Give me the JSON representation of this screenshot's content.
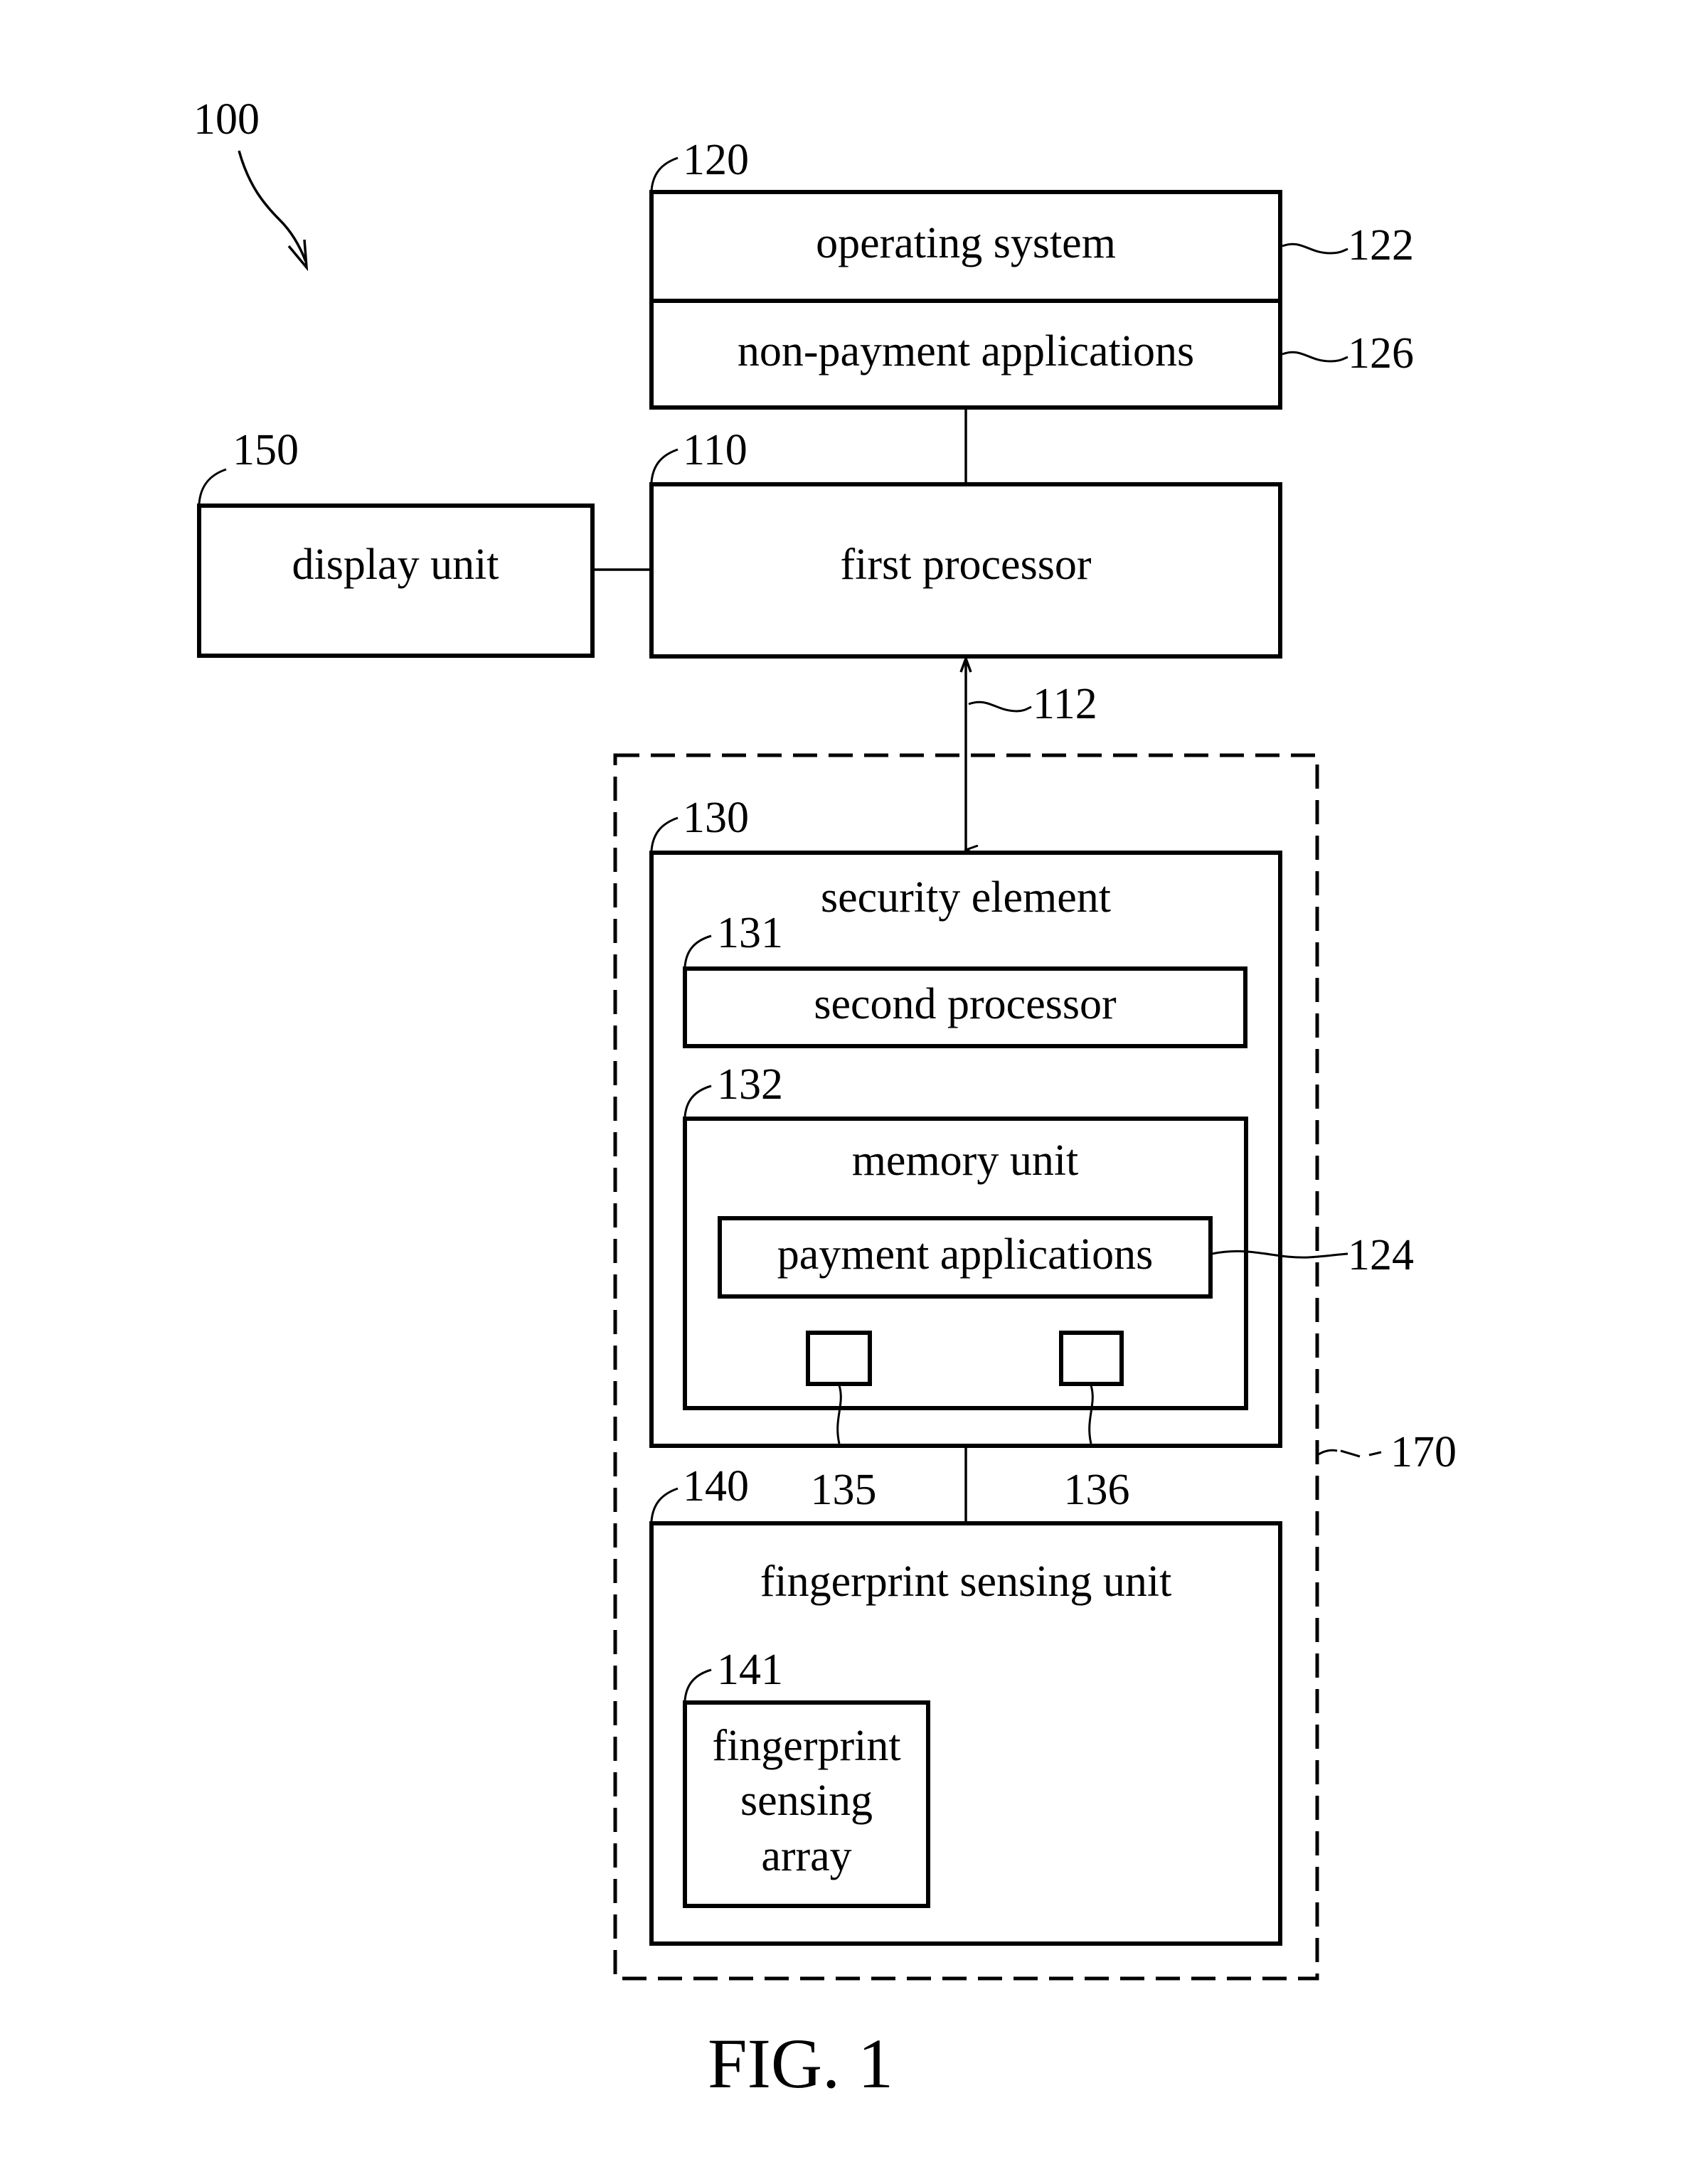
{
  "figure": {
    "caption": "FIG. 1",
    "system_ref": "100"
  },
  "blocks": {
    "os_stack": {
      "ref": "120"
    },
    "operating_system": {
      "label": "operating system",
      "ref": "122"
    },
    "non_payment_apps": {
      "label": "non-payment applications",
      "ref": "126"
    },
    "display_unit": {
      "label": "display unit",
      "ref": "150"
    },
    "first_processor": {
      "label": "first processor",
      "ref": "110"
    },
    "link": {
      "ref": "112"
    },
    "secure_module": {
      "ref": "170"
    },
    "security_element": {
      "label": "security element",
      "ref": "130"
    },
    "second_processor": {
      "label": "second processor",
      "ref": "131"
    },
    "memory_unit": {
      "label": "memory unit",
      "ref": "132"
    },
    "payment_apps": {
      "label": "payment applications",
      "ref": "124"
    },
    "memory_cell_a": {
      "ref": "135"
    },
    "memory_cell_b": {
      "ref": "136"
    },
    "fingerprint_unit": {
      "label": "fingerprint sensing unit",
      "ref": "140"
    },
    "fingerprint_array": {
      "lines": [
        "fingerprint",
        "sensing",
        "array"
      ],
      "ref": "141"
    }
  }
}
